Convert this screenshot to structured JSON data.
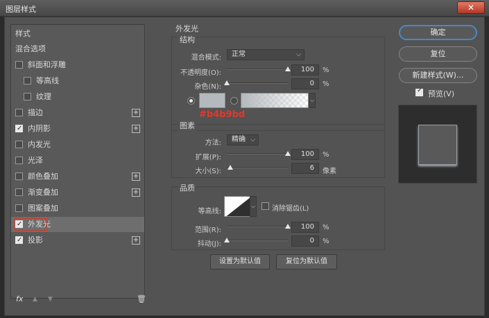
{
  "window": {
    "title": "图层样式",
    "close_label": "✕"
  },
  "left_panel": {
    "items": [
      {
        "label": "样式",
        "checkbox": null,
        "plus": false,
        "selected": false
      },
      {
        "label": "混合选项",
        "checkbox": null,
        "plus": false,
        "selected": false
      },
      {
        "label": "斜面和浮雕",
        "checkbox": false,
        "plus": false,
        "selected": false
      },
      {
        "label": "等高线",
        "checkbox": false,
        "plus": false,
        "selected": false
      },
      {
        "label": "纹理",
        "checkbox": false,
        "plus": false,
        "selected": false
      },
      {
        "label": "描边",
        "checkbox": false,
        "plus": true,
        "selected": false
      },
      {
        "label": "内阴影",
        "checkbox": true,
        "plus": true,
        "selected": false
      },
      {
        "label": "内发光",
        "checkbox": false,
        "plus": false,
        "selected": false
      },
      {
        "label": "光泽",
        "checkbox": false,
        "plus": false,
        "selected": false
      },
      {
        "label": "颜色叠加",
        "checkbox": false,
        "plus": true,
        "selected": false
      },
      {
        "label": "渐变叠加",
        "checkbox": false,
        "plus": true,
        "selected": false
      },
      {
        "label": "图案叠加",
        "checkbox": false,
        "plus": false,
        "selected": false
      },
      {
        "label": "外发光",
        "checkbox": true,
        "plus": false,
        "selected": true
      },
      {
        "label": "投影",
        "checkbox": true,
        "plus": true,
        "selected": false
      }
    ],
    "footer": {
      "fx": "fx",
      "up_icon": "▲",
      "down_icon": "▼",
      "trash_icon": "🗑"
    }
  },
  "outer_glow": {
    "title": "外发光",
    "structure": {
      "title": "结构",
      "blend_mode_label": "混合模式:",
      "blend_mode_value": "正常",
      "opacity_label": "不透明度(O):",
      "opacity_value": "100",
      "noise_label": "杂色(N):",
      "noise_value": "0",
      "percent": "%",
      "color_hex": "#b4b9bd",
      "color_label": "#b4b9bd"
    },
    "elements": {
      "title": "图素",
      "technique_label": "方法:",
      "technique_value": "精确",
      "spread_label": "扩展(P):",
      "spread_value": "100",
      "size_label": "大小(S):",
      "size_value": "6",
      "size_unit": "像素",
      "percent": "%"
    },
    "quality": {
      "title": "品质",
      "contour_label": "等高线:",
      "antialias_label": "消除锯齿(L)",
      "range_label": "范围(R):",
      "range_value": "100",
      "jitter_label": "抖动(J):",
      "jitter_value": "0",
      "percent": "%"
    },
    "buttons": {
      "make_default": "设置为默认值",
      "reset_default": "复位为默认值"
    }
  },
  "right_panel": {
    "ok": "确定",
    "reset": "复位",
    "new_style": "新建样式(W)...",
    "preview_label": "预览(V)",
    "preview_checked": true
  },
  "levels": {
    "opacity": 1.0,
    "noise": 0.0,
    "spread": 1.0,
    "size": 0.06,
    "range": 1.0,
    "jitter": 0.0
  }
}
